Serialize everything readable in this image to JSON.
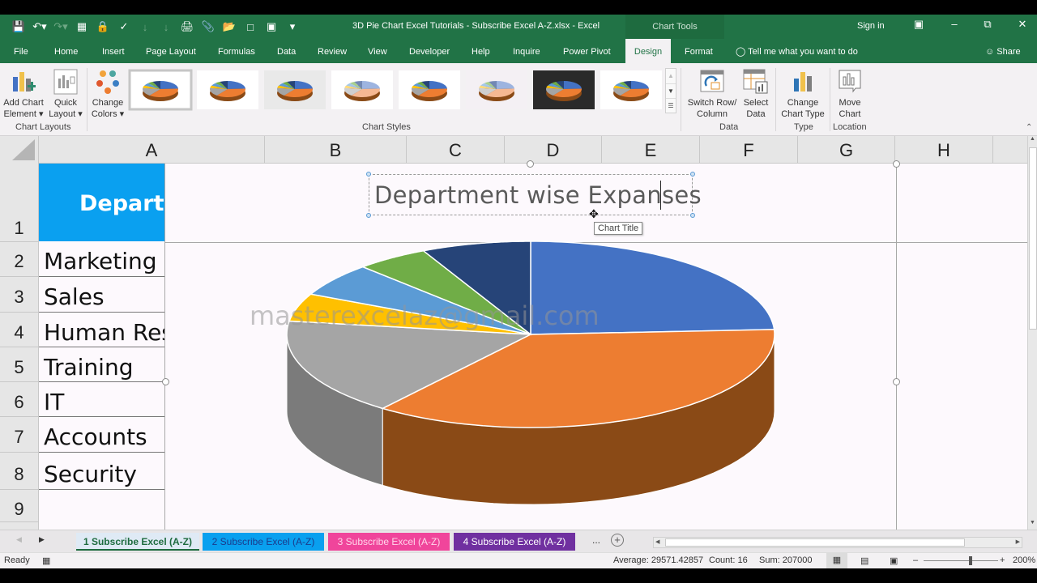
{
  "window": {
    "title": "3D Pie Chart Excel Tutorials - Subscribe Excel A-Z.xlsx  -  Excel",
    "context_group": "Chart Tools",
    "sign_in": "Sign in"
  },
  "qat": {
    "icons": [
      "save-icon",
      "undo-icon",
      "redo-icon",
      "protect-sheet-icon",
      "lock-icon",
      "spelling-icon",
      "sort-ascending-icon",
      "sort-descending-icon",
      "print-preview-icon",
      "attach-icon",
      "open-folder-icon",
      "new-file-icon",
      "window-icon",
      "customize-qat-icon"
    ]
  },
  "ribbon_tabs": [
    "File",
    "Home",
    "Insert",
    "Page Layout",
    "Formulas",
    "Data",
    "Review",
    "View",
    "Developer",
    "Help",
    "Inquire",
    "Power Pivot",
    "Design",
    "Format"
  ],
  "active_tab": "Design",
  "tell_me": "Tell me what you want to do",
  "share": "Share",
  "ribbon": {
    "add_chart_element": [
      "Add Chart",
      "Element ▾"
    ],
    "quick_layout": [
      "Quick",
      "Layout ▾"
    ],
    "change_colors": [
      "Change",
      "Colors ▾"
    ],
    "chart_layouts_label": "Chart Layouts",
    "chart_styles_label": "Chart Styles",
    "switch_row_column": [
      "Switch Row/",
      "Column"
    ],
    "select_data": [
      "Select",
      "Data"
    ],
    "data_label": "Data",
    "change_chart_type": [
      "Change",
      "Chart Type"
    ],
    "type_label": "Type",
    "move_chart": [
      "Move",
      "Chart"
    ],
    "location_label": "Location"
  },
  "columns": [
    "A",
    "B",
    "C",
    "D",
    "E",
    "F",
    "G",
    "H"
  ],
  "rows": [
    "1",
    "2",
    "3",
    "4",
    "5",
    "6",
    "7",
    "8",
    "9"
  ],
  "cells": {
    "A1": "Department",
    "A2": "Marketing",
    "A3": "Sales",
    "A4": "Human Resources",
    "A5": "Training",
    "A6": "IT",
    "A7": "Accounts",
    "A8": "Security"
  },
  "chart": {
    "title": "Department wise Expanses",
    "tooltip": "Chart Title",
    "watermark": "masterexcelaz@gmail.com"
  },
  "chart_data": {
    "type": "pie",
    "variant": "3d-pie",
    "title": "Department wise Expanses",
    "categories": [
      "Marketing",
      "Sales",
      "Human Resources",
      "Training",
      "IT",
      "Accounts",
      "Security"
    ],
    "values": [
      50000,
      75000,
      35000,
      10000,
      12000,
      10000,
      15000
    ],
    "colors": [
      "#4472C4",
      "#ED7D31",
      "#A5A5A5",
      "#FFC000",
      "#5B9BD5",
      "#70AD47",
      "#264478"
    ],
    "side_colors": [
      "#2f5597",
      "#8a4a16",
      "#7b7b7b",
      "#b38600",
      "#3e6f9c",
      "#4d7a31",
      "#1a2f55"
    ],
    "start_angle": "12 o'clock, clockwise",
    "legend": "none"
  },
  "sheet_tabs": [
    {
      "label": "1 Subscribe Excel (A-Z)",
      "color": "#dfeaf5",
      "text": "#1e6b3f",
      "active": true
    },
    {
      "label": "2 Subscribe Excel (A-Z)",
      "color": "#09a0ef",
      "text": "#1b3b8c"
    },
    {
      "label": "3 Subscribe Excel (A-Z)",
      "color": "#f0459b",
      "text": "#ffd6ea"
    },
    {
      "label": "4 Subscribe Excel (A-Z)",
      "color": "#7030a0",
      "text": "#ffffff"
    }
  ],
  "more_sheets": "...",
  "status": {
    "ready": "Ready",
    "average": "Average: 29571.42857",
    "count": "Count: 16",
    "sum": "Sum: 207000",
    "zoom": "200%"
  }
}
